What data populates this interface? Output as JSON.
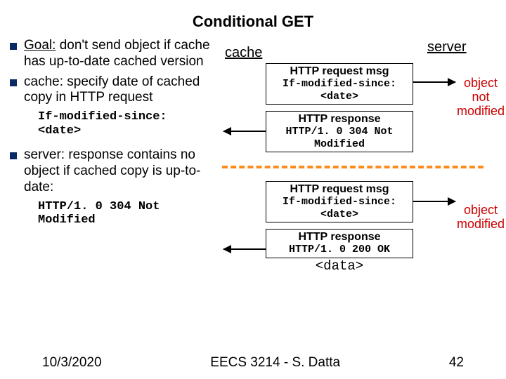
{
  "title": "Conditional GET",
  "bullets": {
    "b1_a": "Goal:",
    "b1_b": " don't send object if cache has up-to-date cached version",
    "b2": "cache: specify date of cached copy in HTTP request",
    "b2_code": "If-modified-since: <date>",
    "b3": "server: response contains no object if cached copy is up-to-date:",
    "b3_code": "HTTP/1. 0 304 Not Modified"
  },
  "labels": {
    "cache": "cache",
    "server": "server"
  },
  "scene1": {
    "req_hdr": "HTTP request msg",
    "req_mono": "If-modified-since: <date>",
    "resp_hdr": "HTTP response",
    "resp_mono": "HTTP/1. 0 304 Not Modified",
    "note": "object not modified"
  },
  "scene2": {
    "req_hdr": "HTTP request msg",
    "req_mono": "If-modified-since: <date>",
    "resp_hdr": "HTTP response",
    "resp_mono": "HTTP/1. 0 200 OK",
    "data": "<data>",
    "note": "object modified"
  },
  "footer": {
    "date": "10/3/2020",
    "course": "EECS 3214 - S. Datta",
    "page": "42"
  }
}
